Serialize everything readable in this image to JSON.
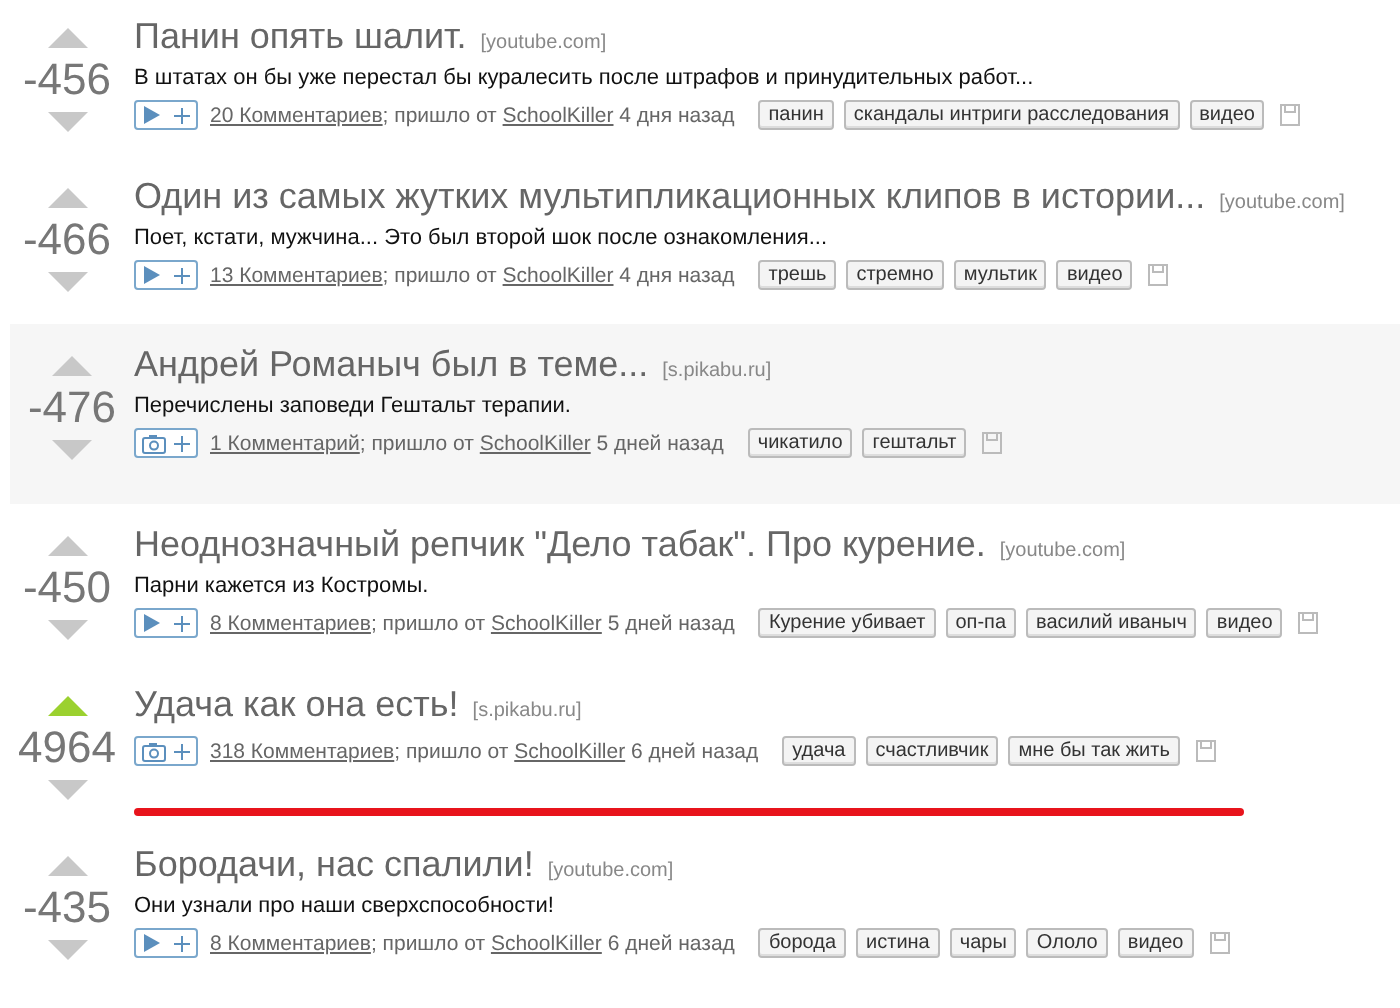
{
  "posts": [
    {
      "rating": "-456",
      "upvoted": false,
      "highlighted": false,
      "underlined": false,
      "title": "Панин опять шалит.",
      "source": "[youtube.com]",
      "description": "В штатах он бы уже перестал бы куралесить после штрафов и принудительных работ...",
      "kind": "video",
      "comments": "20 Комментариев",
      "via": "; пришло от",
      "author": "SchoolKiller",
      "time": "4 дня назад",
      "tags": [
        "панин",
        "скандалы интриги расследования",
        "видео"
      ]
    },
    {
      "rating": "-466",
      "upvoted": false,
      "highlighted": false,
      "underlined": false,
      "title": "Один из самых жутких мультипликационных клипов в истории...",
      "source": "[youtube.com]",
      "description": "Поет, кстати, мужчина... Это был второй шок после ознакомления...",
      "kind": "video",
      "comments": "13 Комментариев",
      "via": "; пришло от",
      "author": "SchoolKiller",
      "time": "4 дня назад",
      "tags": [
        "трешь",
        "стремно",
        "мультик",
        "видео"
      ]
    },
    {
      "rating": "-476",
      "upvoted": false,
      "highlighted": true,
      "underlined": false,
      "title": "Андрей Романыч был в теме...",
      "source": "[s.pikabu.ru]",
      "description": "Перечислены заповеди Гештальт терапии.",
      "kind": "photo",
      "comments": "1 Комментарий",
      "via": "; пришло от",
      "author": "SchoolKiller",
      "time": "5 дней назад",
      "tags": [
        "чикатило",
        "гештальт"
      ]
    },
    {
      "rating": "-450",
      "upvoted": false,
      "highlighted": false,
      "underlined": false,
      "title": "Неоднозначный репчик \"Дело табак\". Про курение.",
      "source": "[youtube.com]",
      "description": "Парни кажется из Костромы.",
      "kind": "video",
      "comments": "8 Комментариев",
      "via": "; пришло от",
      "author": "SchoolKiller",
      "time": "5 дней назад",
      "tags": [
        "Курение убивает",
        "оп-па",
        "василий иваныч",
        "видео"
      ]
    },
    {
      "rating": "4964",
      "upvoted": true,
      "highlighted": false,
      "underlined": true,
      "title": "Удача как она есть!",
      "source": "[s.pikabu.ru]",
      "kind": "photo",
      "comments": "318 Комментариев",
      "via": "; пришло от",
      "author": "SchoolKiller",
      "time": "6 дней назад",
      "tags": [
        "удача",
        "счастливчик",
        "мне бы так жить"
      ]
    },
    {
      "rating": "-435",
      "upvoted": false,
      "highlighted": false,
      "underlined": false,
      "title": "Бородачи, нас спалили!",
      "source": "[youtube.com]",
      "description": "Они узнали про наши сверхспособности!",
      "kind": "video",
      "comments": "8 Комментариев",
      "via": "; пришло от",
      "author": "SchoolKiller",
      "time": "6 дней назад",
      "tags": [
        "борода",
        "истина",
        "чары",
        "Ололо",
        "видео"
      ]
    }
  ]
}
